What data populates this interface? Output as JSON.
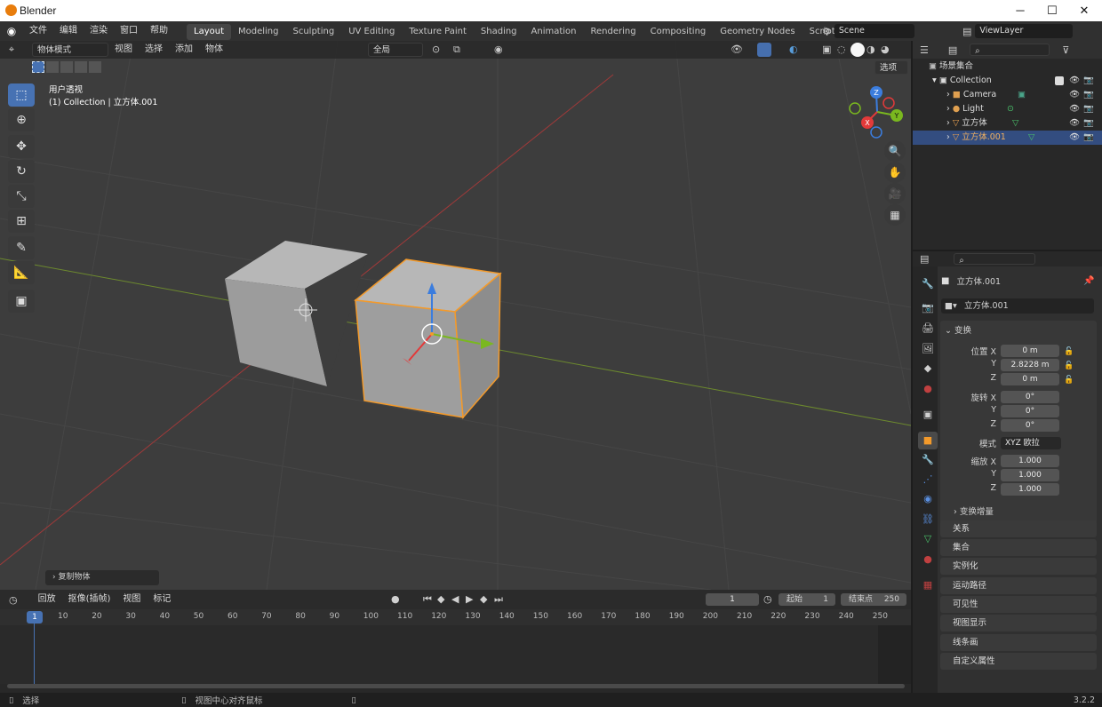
{
  "window": {
    "title": "Blender",
    "minimize": "─",
    "maximize": "☐",
    "close": "✕"
  },
  "topbar": {
    "menus": [
      "文件",
      "编辑",
      "渲染",
      "窗口",
      "帮助"
    ],
    "workspaces": [
      "Layout",
      "Modeling",
      "Sculpting",
      "UV Editing",
      "Texture Paint",
      "Shading",
      "Animation",
      "Rendering",
      "Compositing",
      "Geometry Nodes",
      "Scripting"
    ],
    "active_workspace": "Layout",
    "add_tab": "+",
    "scene": "Scene",
    "view_layer": "ViewLayer"
  },
  "viewport": {
    "mode": "物体模式",
    "menus": [
      "视图",
      "选择",
      "添加",
      "物体"
    ],
    "orientation": "全局",
    "options": "选项",
    "overlay_title": "用户透视",
    "overlay_subtitle": "(1) Collection | 立方体.001",
    "last_operator": "复制物体",
    "gizmo_axes": {
      "x": "X",
      "y": "Y",
      "z": "Z"
    }
  },
  "outliner": {
    "root": "场景集合",
    "collection": "Collection",
    "items": [
      {
        "name": "Camera",
        "color": "#e0a050"
      },
      {
        "name": "Light",
        "color": "#e0a050"
      },
      {
        "name": "立方体",
        "color": "#e8a050"
      },
      {
        "name": "立方体.001",
        "color": "#e8a050"
      }
    ],
    "selected": "立方体.001"
  },
  "properties": {
    "object_name": "立方体.001",
    "datablock": "立方体.001",
    "transform_header": "变换",
    "location_label": "位置 X",
    "rotation_label": "旋转 X",
    "scale_label": "缩放 X",
    "y_label": "Y",
    "z_label": "Z",
    "location": [
      "0 m",
      "2.8228 m",
      "0 m"
    ],
    "rotation": [
      "0°",
      "0°",
      "0°"
    ],
    "mode_label": "模式",
    "mode_value": "XYZ 欧拉",
    "scale": [
      "1.000",
      "1.000",
      "1.000"
    ],
    "delta_transform": "变换增量",
    "panels": [
      "关系",
      "集合",
      "实例化",
      "运动路径",
      "可见性",
      "视图显示",
      "线条画",
      "自定义属性"
    ]
  },
  "timeline": {
    "menus": [
      "回放",
      "抠像(插帧)",
      "视图",
      "标记"
    ],
    "current_frame": "1",
    "start_label": "起始",
    "start": "1",
    "end_label": "结束点",
    "end": "250",
    "ruler": [
      "10",
      "20",
      "30",
      "40",
      "50",
      "60",
      "70",
      "80",
      "90",
      "100",
      "110",
      "120",
      "130",
      "140",
      "150",
      "160",
      "170",
      "180",
      "190",
      "200",
      "210",
      "220",
      "230",
      "240",
      "250"
    ],
    "playhead": "1"
  },
  "status": {
    "select": "选择",
    "center": "视图中心对齐鼠标",
    "version": "3.2.2"
  }
}
